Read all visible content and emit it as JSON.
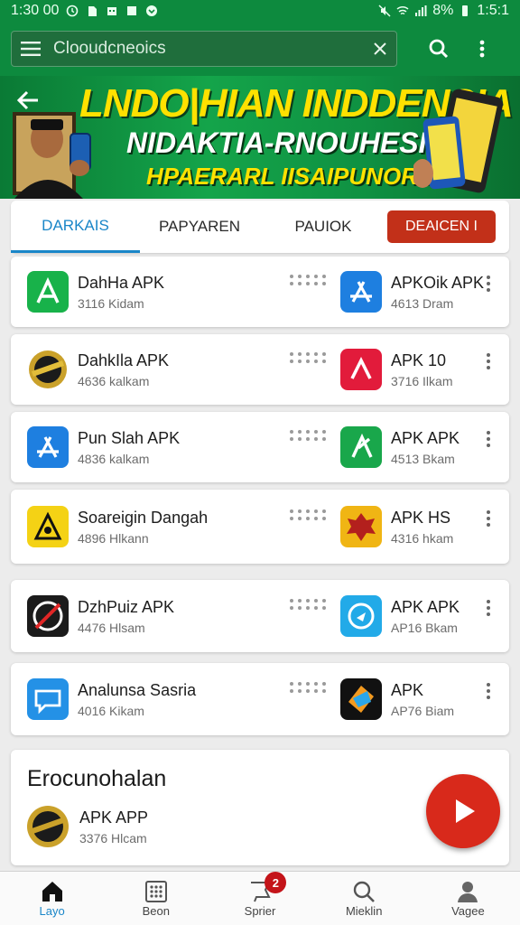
{
  "status_bar": {
    "time_left": "1:30 00",
    "battery": "8%",
    "time_right": "1:5:1"
  },
  "app_bar": {
    "search_query": "Clooudcneoics"
  },
  "banner": {
    "line1": "LNDO|HIAN INDDENSIA",
    "line2": "NIDAKTIA-RNOUHESI",
    "line3": "HPAERARL IISAIPUNORIANI"
  },
  "tabs": {
    "items": [
      "DARKAIS",
      "PAPYAREN",
      "PAUIOK"
    ],
    "cta": "DEAICEN I"
  },
  "rows": [
    {
      "left": {
        "name": "DahHa APK",
        "size": "3116 Kidam",
        "icon": "a-arrow-icon",
        "color": "#18b24a"
      },
      "right": {
        "name": "APKOik APK",
        "size": "4613 Dram",
        "icon": "appstore-a-icon",
        "color": "#1e7fe0"
      }
    },
    {
      "left": {
        "name": "DahkIla APK",
        "size": "4636 kalkam",
        "icon": "gold-seal-icon",
        "color": "#1b1b1b"
      },
      "right": {
        "name": "APK 10",
        "size": "3716 Ilkam",
        "icon": "red-a-icon",
        "color": "#e21b3b"
      }
    },
    {
      "left": {
        "name": "Pun Slah APK",
        "size": "4836 kalkam",
        "icon": "appstore-a-icon",
        "color": "#1e7fe0"
      },
      "right": {
        "name": "APK APK",
        "size": "4513 Bkam",
        "icon": "green-k-icon",
        "color": "#19a74b"
      }
    },
    {
      "left": {
        "name": "Soareigin Dangah",
        "size": "4896 Hlkann",
        "icon": "triangle-d-icon",
        "color": "#f4d215"
      },
      "right": {
        "name": "APK HS",
        "size": "4316 hkam",
        "icon": "red-dragon-icon",
        "color": "#f0b514"
      }
    },
    {
      "left": {
        "name": "DzhPuiz APK",
        "size": "4476 Hlsam",
        "icon": "no-symbol-icon",
        "color": "#1b1b1b"
      },
      "right": {
        "name": "APK APK",
        "size": "AP16 Bkam",
        "icon": "cyan-circle-icon",
        "color": "#22aae8"
      }
    },
    {
      "left": {
        "name": "Analunsa Sasria",
        "size": "4016 Kikam",
        "icon": "chat-bubble-icon",
        "color": "#2491e6"
      },
      "right": {
        "name": "APK",
        "size": "AP76 Biam",
        "icon": "colorful-diamond-icon",
        "color": "#111111"
      }
    }
  ],
  "featured": {
    "heading": "Erocunohalan",
    "app_name": "APK APP",
    "app_size": "3376 Hlcam",
    "icon": "gold-seal-icon"
  },
  "bottom_nav": [
    {
      "label": "Layo",
      "icon": "home-icon"
    },
    {
      "label": "Beon",
      "icon": "grid-icon"
    },
    {
      "label": "Sprier",
      "icon": "flag-icon",
      "badge": "2"
    },
    {
      "label": "Mieklin",
      "icon": "search-icon"
    },
    {
      "label": "Vagee",
      "icon": "person-icon"
    }
  ]
}
